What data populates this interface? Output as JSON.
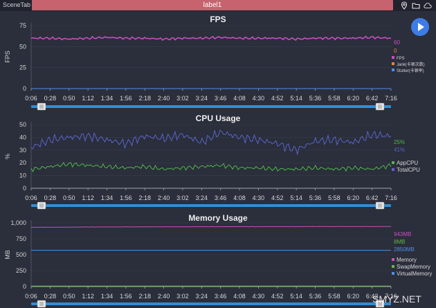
{
  "toolbar": {
    "scene_tab": "SceneTab",
    "label": "label1",
    "icons": [
      "location-icon",
      "folder-icon",
      "cloud-icon"
    ]
  },
  "play_button": {
    "icon": "play-icon"
  },
  "x_ticks": [
    "0:06",
    "0:28",
    "0:50",
    "1:12",
    "1:34",
    "1:56",
    "2:18",
    "2:40",
    "3:02",
    "3:24",
    "3:46",
    "4:08",
    "4:30",
    "4:52",
    "5:14",
    "5:36",
    "5:58",
    "6:20",
    "6:42",
    "7:16"
  ],
  "charts": {
    "fps": {
      "title": "FPS",
      "ylabel": "FPS",
      "yticks": [
        "75",
        "50",
        "25",
        "0"
      ],
      "values": [
        "60",
        "0"
      ],
      "legend": [
        "FPS",
        "Jank(卡顿次数)",
        "Stutter(卡顿率)"
      ]
    },
    "cpu": {
      "title": "CPU Usage",
      "ylabel": "%",
      "yticks": [
        "50",
        "40",
        "30",
        "20",
        "10",
        "0"
      ],
      "values": [
        "25%",
        "41%"
      ],
      "legend": [
        "AppCPU",
        "TotalCPU"
      ]
    },
    "mem": {
      "title": "Memory Usage",
      "ylabel": "MB",
      "yticks": [
        "1,000",
        "750",
        "500",
        "250",
        "0"
      ],
      "values": [
        "943MB",
        "8MB",
        "2850MB"
      ],
      "legend": [
        "Memory",
        "SwapMemory",
        "VirtualMemory"
      ]
    }
  },
  "watermark": "SMYZ.NET",
  "colors": {
    "background": "#2b2e3b",
    "fps": "#c94fc0",
    "jank": "#e8823c",
    "stutter": "#4d8fe8",
    "app_cpu": "#4fb84a",
    "total_cpu": "#5865c8",
    "memory": "#c94fc0",
    "swap": "#5fb84a",
    "virtual": "#4d8fe8",
    "scrollbar": "#2f8fd8"
  },
  "chart_data": [
    {
      "type": "line",
      "title": "FPS",
      "ylabel": "FPS",
      "ylim": [
        0,
        75
      ],
      "series": [
        {
          "name": "FPS",
          "values": [
            60,
            60,
            59,
            60,
            61,
            60,
            60,
            59,
            60,
            60,
            61,
            60,
            60,
            60,
            59,
            60,
            60,
            60,
            61,
            60
          ]
        },
        {
          "name": "Jank(卡顿次数)",
          "values": [
            0,
            0,
            0,
            0,
            0,
            0,
            0,
            0,
            0,
            0,
            0,
            0,
            0,
            0,
            0,
            0,
            0,
            0,
            0,
            0
          ]
        },
        {
          "name": "Stutter(卡顿率)",
          "values": [
            0,
            0,
            0,
            0,
            0,
            0,
            0,
            0,
            0,
            0,
            0,
            0,
            0,
            0,
            0,
            0,
            0,
            0,
            0,
            0
          ]
        }
      ]
    },
    {
      "type": "line",
      "title": "CPU Usage",
      "ylabel": "%",
      "ylim": [
        0,
        50
      ],
      "series": [
        {
          "name": "AppCPU",
          "values": [
            15,
            17,
            19,
            18,
            17,
            16,
            17,
            15,
            16,
            17,
            18,
            16,
            16,
            15,
            15,
            16,
            15,
            16,
            15,
            18
          ]
        },
        {
          "name": "TotalCPU",
          "values": [
            32,
            38,
            40,
            41,
            38,
            35,
            41,
            39,
            42,
            36,
            44,
            40,
            38,
            35,
            30,
            37,
            38,
            36,
            42,
            41
          ]
        }
      ]
    },
    {
      "type": "line",
      "title": "Memory Usage",
      "ylabel": "MB",
      "ylim": [
        0,
        1000
      ],
      "series": [
        {
          "name": "Memory",
          "values": [
            930,
            932,
            933,
            935,
            936,
            937,
            938,
            938,
            939,
            940,
            940,
            941,
            941,
            942,
            942,
            943,
            943,
            943,
            943,
            943
          ]
        },
        {
          "name": "SwapMemory",
          "values": [
            8,
            8,
            8,
            8,
            8,
            8,
            8,
            8,
            8,
            8,
            8,
            8,
            8,
            8,
            8,
            8,
            8,
            8,
            8,
            8
          ]
        },
        {
          "name": "VirtualMemory",
          "values": [
            570,
            570,
            570,
            570,
            570,
            570,
            570,
            570,
            570,
            570,
            570,
            570,
            570,
            570,
            570,
            570,
            570,
            570,
            570,
            570
          ]
        }
      ]
    }
  ]
}
